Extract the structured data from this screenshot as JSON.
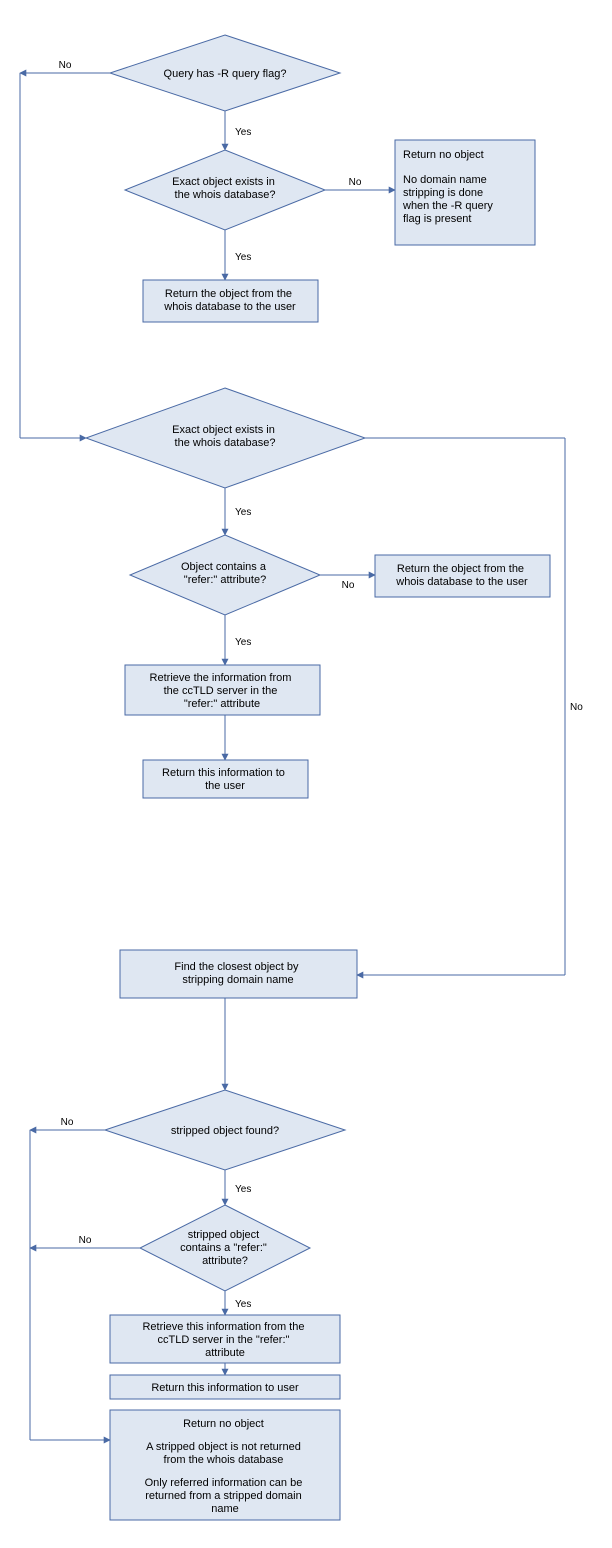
{
  "flowchart": {
    "nodes": {
      "d1": {
        "type": "decision",
        "text": "Query has -R query flag?"
      },
      "d2": {
        "type": "decision",
        "text": "Exact object exists in the whois database?"
      },
      "p1": {
        "type": "process",
        "text": "Return no object\n\nNo domain name stripping is done when the -R query flag is present"
      },
      "p2": {
        "type": "process",
        "text": "Return the object from the whois database to the user"
      },
      "d3": {
        "type": "decision",
        "text": "Exact object exists in the whois database?"
      },
      "d4": {
        "type": "decision",
        "text": "Object contains a \"refer:\" attribute?"
      },
      "p3": {
        "type": "process",
        "text": "Return the object from the whois database to the user"
      },
      "p4": {
        "type": "process",
        "text": "Retrieve the information from the ccTLD server in the \"refer:\" attribute"
      },
      "p5": {
        "type": "process",
        "text": "Return this information to the user"
      },
      "p6": {
        "type": "process",
        "text": "Find the closest object by stripping domain name"
      },
      "d5": {
        "type": "decision",
        "text": "stripped object found?"
      },
      "d6": {
        "type": "decision",
        "text": "stripped object contains a \"refer:\" attribute?"
      },
      "p7": {
        "type": "process",
        "text": "Retrieve this information from the ccTLD server in the \"refer:\" attribute"
      },
      "p8": {
        "type": "process",
        "text": "Return this information to user"
      },
      "p9": {
        "type": "process",
        "text": "Return no object\n\nA stripped object is not returned from the whois database\n\nOnly referred information can be returned from a stripped domain name"
      }
    },
    "edges": {
      "yes": "Yes",
      "no": "No"
    }
  }
}
